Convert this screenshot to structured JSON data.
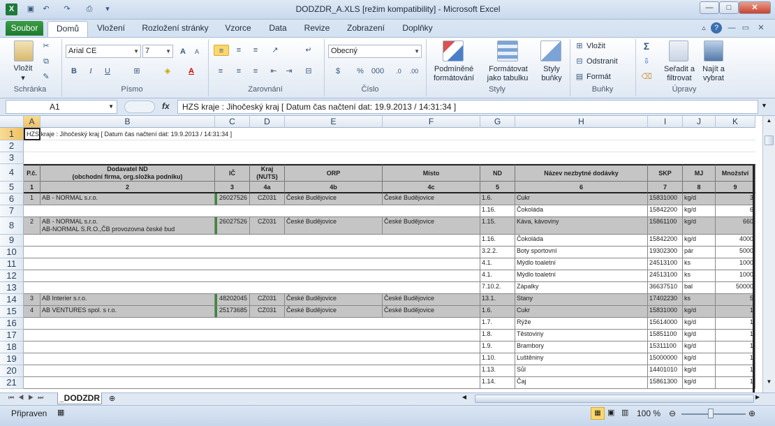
{
  "window": {
    "title": "DODZDR_A.XLS  [režim kompatibility]  -  Microsoft Excel",
    "logo": "X"
  },
  "ribbon_tabs": [
    "Soubor",
    "Domů",
    "Vložení",
    "Rozložení stránky",
    "Vzorce",
    "Data",
    "Revize",
    "Zobrazení",
    "Doplňky"
  ],
  "clipboard": {
    "paste": "Vložit",
    "label": "Schránka"
  },
  "font": {
    "name": "Arial CE",
    "size": "7",
    "bold": "B",
    "italic": "I",
    "underline": "U",
    "label": "Písmo"
  },
  "alignment": {
    "label": "Zarovnání"
  },
  "number": {
    "format": "Obecný",
    "percent": "%",
    "thousands": "000",
    "label": "Číslo"
  },
  "styles": {
    "cond1": "Podmíněné",
    "cond2": "formátování",
    "table1": "Formátovat",
    "table2": "jako tabulku",
    "cell1": "Styly",
    "cell2": "buňky",
    "label": "Styly"
  },
  "cells_group": {
    "insert": "Vložit",
    "delete": "Odstranit",
    "format": "Formát",
    "label": "Buňky"
  },
  "editing": {
    "sum": "Σ",
    "sort1": "Seřadit a",
    "sort2": "filtrovat",
    "find1": "Najít a",
    "find2": "vybrat",
    "label": "Úpravy"
  },
  "formula_bar": {
    "name_box": "A1",
    "fx": "fx",
    "formula": "HZS kraje : Jihočeský kraj [ Datum čas načtení dat: 19.9.2013 / 14:31:34 ]"
  },
  "columns": [
    "A",
    "B",
    "C",
    "D",
    "E",
    "F",
    "G",
    "H",
    "I",
    "J",
    "K"
  ],
  "rows": [
    "1",
    "2",
    "3",
    "4",
    "5",
    "6",
    "7",
    "8",
    "9",
    "10",
    "11",
    "12",
    "13",
    "14",
    "15",
    "16",
    "17",
    "18",
    "19",
    "20",
    "21"
  ],
  "sheet_title": "HZS kraje : Jihočeský kraj [ Datum čas načtení dat: 19.9.2013 / 14:31:34 ]",
  "headers": [
    "P.č.",
    "Dodavatel ND\n(obchodní firma, org.složka podniku)",
    "IČ",
    "Kraj\n(NUTS)",
    "ORP",
    "Místo",
    "ND",
    "Název nezbytné dodávky",
    "SKP",
    "MJ",
    "Množství"
  ],
  "header_nums": [
    "1",
    "2",
    "3",
    "4a",
    "4b",
    "4c",
    "5",
    "6",
    "7",
    "8",
    "9"
  ],
  "data_rows": [
    {
      "a": "1",
      "b": "AB - NORMAL s.r.o.",
      "c": "26027526",
      "d": "CZ031",
      "e": "České Budějovice",
      "f": "České Budějovice",
      "g": "1.6.",
      "h": "Cukr",
      "i": "15831000",
      "j": "kg/d",
      "k": "3"
    },
    {
      "a": "",
      "b": "",
      "c": "",
      "d": "",
      "e": "",
      "f": "",
      "g": "1.16.",
      "h": "Čokoláda",
      "i": "15842200",
      "j": "kg/d",
      "k": "6"
    },
    {
      "a": "2",
      "b": "AB - NORMAL s.r.o.\nAB-NORMAL S.R.O.,ČB provozovna české bud",
      "c": "26027526",
      "d": "CZ031",
      "e": "České Budějovice",
      "f": "České Budějovice",
      "g": "1.15.",
      "h": "Káva, kávoviny",
      "i": "15861100",
      "j": "kg/d",
      "k": "660"
    },
    {
      "a": "",
      "b": "",
      "c": "",
      "d": "",
      "e": "",
      "f": "",
      "g": "1.16.",
      "h": "Čokoláda",
      "i": "15842200",
      "j": "kg/d",
      "k": "4000"
    },
    {
      "a": "",
      "b": "",
      "c": "",
      "d": "",
      "e": "",
      "f": "",
      "g": "3.2.2.",
      "h": "Boty sportovní",
      "i": "19302300",
      "j": "pár",
      "k": "5000"
    },
    {
      "a": "",
      "b": "",
      "c": "",
      "d": "",
      "e": "",
      "f": "",
      "g": "4.1.",
      "h": "Mýdlo toaletní",
      "i": "24513100",
      "j": "ks",
      "k": "1000"
    },
    {
      "a": "",
      "b": "",
      "c": "",
      "d": "",
      "e": "",
      "f": "",
      "g": "4.1.",
      "h": "Mýdlo toaletní",
      "i": "24513100",
      "j": "ks",
      "k": "1000"
    },
    {
      "a": "",
      "b": "",
      "c": "",
      "d": "",
      "e": "",
      "f": "",
      "g": "7.10.2.",
      "h": "Zápalky",
      "i": "36637510",
      "j": "bal",
      "k": "50000"
    },
    {
      "a": "3",
      "b": "AB Interier s.r.o.",
      "c": "48202045",
      "d": "CZ031",
      "e": "České Budějovice",
      "f": "České Budějovice",
      "g": "13.1.",
      "h": "Stany",
      "i": "17402230",
      "j": "ks",
      "k": "5"
    },
    {
      "a": "4",
      "b": "AB VENTURES spol. s r.o.",
      "c": "25173685",
      "d": "CZ031",
      "e": "České Budějovice",
      "f": "České Budějovice",
      "g": "1.6.",
      "h": "Cukr",
      "i": "15831000",
      "j": "kg/d",
      "k": "1"
    },
    {
      "a": "",
      "b": "",
      "c": "",
      "d": "",
      "e": "",
      "f": "",
      "g": "1.7.",
      "h": "Rýže",
      "i": "15614000",
      "j": "kg/d",
      "k": "1"
    },
    {
      "a": "",
      "b": "",
      "c": "",
      "d": "",
      "e": "",
      "f": "",
      "g": "1.8.",
      "h": "Těstoviny",
      "i": "15851100",
      "j": "kg/d",
      "k": "1"
    },
    {
      "a": "",
      "b": "",
      "c": "",
      "d": "",
      "e": "",
      "f": "",
      "g": "1.9.",
      "h": "Brambory",
      "i": "15311100",
      "j": "kg/d",
      "k": "1"
    },
    {
      "a": "",
      "b": "",
      "c": "",
      "d": "",
      "e": "",
      "f": "",
      "g": "1.10.",
      "h": "Luštěniny",
      "i": "15000000",
      "j": "kg/d",
      "k": "1"
    },
    {
      "a": "",
      "b": "",
      "c": "",
      "d": "",
      "e": "",
      "f": "",
      "g": "1.13.",
      "h": "Sůl",
      "i": "14401010",
      "j": "kg/d",
      "k": "1"
    },
    {
      "a": "",
      "b": "",
      "c": "",
      "d": "",
      "e": "",
      "f": "",
      "g": "1.14.",
      "h": "Čaj",
      "i": "15861300",
      "j": "kg/d",
      "k": "1"
    }
  ],
  "sheet_tab": "_DODZDR",
  "status": {
    "ready": "Připraven",
    "zoom": "100 %"
  }
}
